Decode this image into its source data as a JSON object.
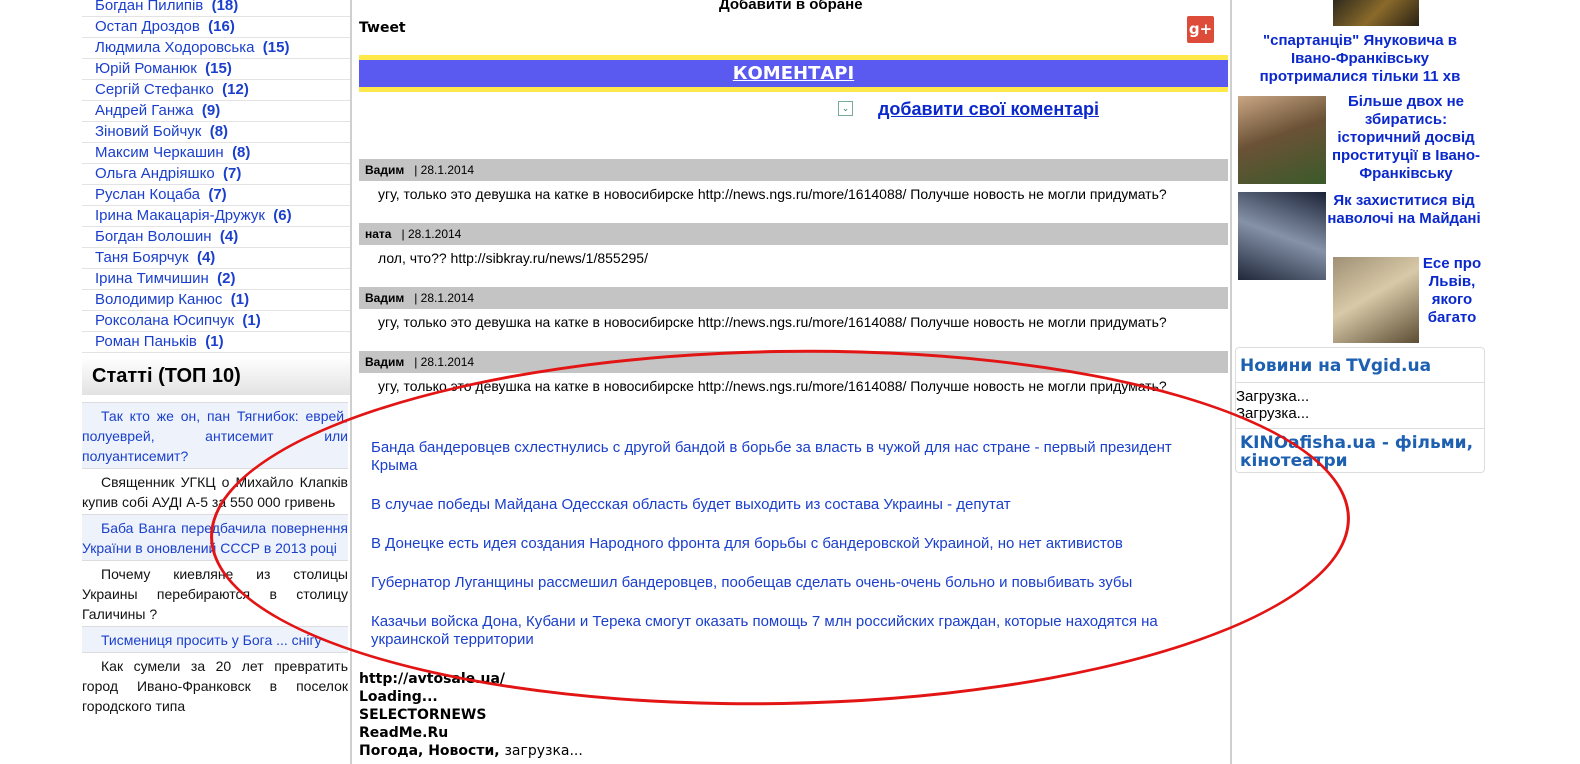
{
  "authors": [
    {
      "name": "Богдан Пилипів",
      "count": "(18)"
    },
    {
      "name": "Остап Дроздов",
      "count": "(16)"
    },
    {
      "name": "Людмила Ходоровська",
      "count": "(15)"
    },
    {
      "name": "Юрій Романюк",
      "count": "(15)"
    },
    {
      "name": "Сергій Стефанко",
      "count": "(12)"
    },
    {
      "name": "Андрей Ганжа",
      "count": "(9)"
    },
    {
      "name": "Зіновий Бойчук",
      "count": "(8)"
    },
    {
      "name": "Максим Черкашин",
      "count": "(8)"
    },
    {
      "name": "Ольга Андріяшко",
      "count": "(7)"
    },
    {
      "name": "Руслан Коцаба",
      "count": "(7)"
    },
    {
      "name": "Ірина Макацарія-Дружук",
      "count": "(6)"
    },
    {
      "name": "Богдан Волошин",
      "count": "(4)"
    },
    {
      "name": "Таня Боярчук",
      "count": "(4)"
    },
    {
      "name": "Ірина Тимчишин",
      "count": "(2)"
    },
    {
      "name": "Володимир Канюс",
      "count": "(1)"
    },
    {
      "name": "Роксолана Юсипчук",
      "count": "(1)"
    },
    {
      "name": "Роман Паньків",
      "count": "(1)"
    }
  ],
  "articles": {
    "title": "Статті (ТОП 10)",
    "items": [
      "Так кто же он, пан Тягнибок: еврей, полуеврей, антисемит или полуантисемит?",
      "Священник УГКЦ о Михайло Клапків купив собі АУДІ А-5 за 550 000 гривень",
      "Баба Ванга передбачила повернення України в оновлений СССР в 2013 році",
      "Почему киевляне из столицы Украины перебираются в столицу Галичины ?",
      "Тисмениця просить у Бога ... снігу",
      "Как сумели за 20 лет превратить город Ивано-Франковск в поселок городского типа"
    ]
  },
  "center": {
    "favorites": "Добавити в обране",
    "tweet": "Tweet",
    "gplus": "g+",
    "comments_title": "КОМЕНТАРІ",
    "add_comment": "добавити свої коментарі",
    "comments": [
      {
        "author": "Вадим",
        "date": "| 28.1.2014",
        "text": "угу, только это девушка на катке в новосибирске http://news.ngs.ru/more/1614088/ Получше новость не могли придумать?"
      },
      {
        "author": "ната",
        "date": "| 28.1.2014",
        "text": "лол, что?? http://sibkray.ru/news/1/855295/"
      },
      {
        "author": "Вадим",
        "date": "| 28.1.2014",
        "text": "угу, только это девушка на катке в новосибирске http://news.ngs.ru/more/1614088/ Получше новость не могли придумать?"
      },
      {
        "author": "Вадим",
        "date": "| 28.1.2014",
        "text": "угу, только это девушка на катке в новосибирске http://news.ngs.ru/more/1614088/ Получше новость не могли придумать?"
      }
    ],
    "news": [
      "Банда бандеровцев схлестнулись с другой бандой в борьбе за власть в чужой для нас стране - первый президент Крыма",
      "В случае победы Майдана Одесская область будет выходить из состава Украины - депутат",
      "В Донецке есть идея создания Народного фронта для борьбы с бандеровской Украиной, но нет активистов",
      "Губернатор Луганщины рассмешил бандеровцев, пообещав сделать очень-очень больно и повыбивать зубы",
      "Казачьи войска Дона, Кубани и Терека смогут оказать помощь 7 млн российских граждан, которые находятся на украинской территории"
    ],
    "bottom": {
      "l1": "http://avtosale.ua/",
      "l2": "Loading...",
      "l3": "SELECTORNEWS",
      "l4": "ReadMe.Ru",
      "l5a": "Погода,",
      "l5b": "Новости,",
      "l5c": "загрузка..."
    }
  },
  "right": {
    "link1": "\"спартанців\" Януковича в Івано-Франківську протрималися тільки 11 хв",
    "link2": "Більше двох не збиратись: історичний досвід проституції в Івано-Франківську",
    "link3": "Як захиститися від наволочі на Майдані",
    "link4": "Есе про Львів, якого багато",
    "tv_prefix": "Новини на",
    "tv_site": "TVgid.ua",
    "loading1": "Загрузка...",
    "loading2": "Загрузка...",
    "kino": "KINOafisha.ua - фільми, кінотеатри"
  },
  "colors": {
    "link": "#0033cc",
    "bar": "#5a5af0",
    "bar_border": "#ffe84a",
    "annotation": "#e21414"
  }
}
